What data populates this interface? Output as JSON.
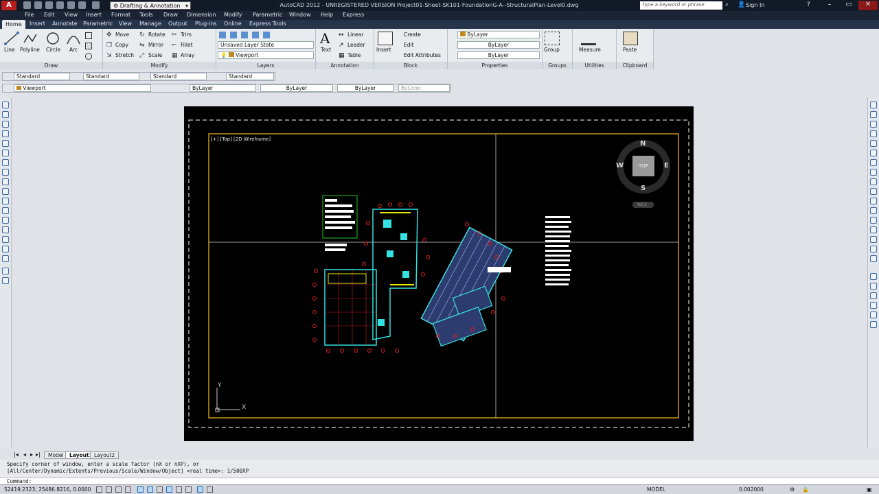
{
  "titlebar": {
    "workspace": "Drafting & Annotation",
    "title": "AutoCAD 2012 - UNREGISTERED VERSION   Project01-Sheet-SK101-FoundationG-A--StructuralPlan-Level0.dwg",
    "search_placeholder": "Type a keyword or phrase",
    "sign_in": "Sign In"
  },
  "menubar": [
    "File",
    "Edit",
    "View",
    "Insert",
    "Format",
    "Tools",
    "Draw",
    "Dimension",
    "Modify",
    "Parametric",
    "Window",
    "Help",
    "Express"
  ],
  "ribbon_tabs": [
    "Home",
    "Insert",
    "Annotate",
    "Parametric",
    "View",
    "Manage",
    "Output",
    "Plug-ins",
    "Online",
    "Express Tools"
  ],
  "ribbon": {
    "draw": {
      "title": "Draw",
      "tools": [
        "Line",
        "Polyline",
        "Circle",
        "Arc"
      ]
    },
    "modify": {
      "title": "Modify",
      "col1": [
        "Move",
        "Copy",
        "Stretch"
      ],
      "col2": [
        "Rotate",
        "Mirror",
        "Scale"
      ],
      "col3": [
        "Trim",
        "Fillet",
        "Array"
      ]
    },
    "layers": {
      "title": "Layers",
      "layer_state": "Unsaved Layer State",
      "current_layer": "Viewport"
    },
    "annotation": {
      "title": "Annotation",
      "text": "Text",
      "items": [
        "Linear",
        "Leader",
        "Table"
      ]
    },
    "block": {
      "title": "Block",
      "insert": "Insert",
      "items": [
        "Create",
        "Edit",
        "Edit Attributes"
      ]
    },
    "properties": {
      "title": "Properties",
      "color": "ByLayer",
      "linetype": "ByLayer",
      "lineweight": "ByLayer"
    },
    "groups": {
      "title": "Groups",
      "group": "Group"
    },
    "utilities": {
      "title": "Utilities",
      "measure": "Measure"
    },
    "clipboard": {
      "title": "Clipboard",
      "paste": "Paste"
    }
  },
  "styles_toolbar": {
    "text_style": "Standard",
    "dim_style": "Standard",
    "table_style": "Standard",
    "mleader_style": "Standard"
  },
  "layers_toolbar": {
    "layer": "Viewport",
    "color": "ByLayer",
    "linetype": "ByLayer",
    "lineweight": "ByLayer",
    "plotstyle": "ByColor"
  },
  "viewport": {
    "label": "[+] [Top] [2D Wireframe]"
  },
  "viewcube": {
    "n": "N",
    "s": "S",
    "e": "E",
    "w": "W",
    "face": "TOP",
    "ucs": "WCS"
  },
  "ucs_icon": {
    "x": "X",
    "y": "Y"
  },
  "layout_tabs": [
    "Model",
    "Layout1",
    "Layout2"
  ],
  "active_layout": "Layout1",
  "command": {
    "history1": "Specify corner of window, enter a scale factor (nX or nXP), or",
    "history2": "[All/Center/Dynamic/Extents/Previous/Scale/Window/Object] <real time>: 1/500XP",
    "prompt": "Command:"
  },
  "status": {
    "coords": "52419.2323, 25486.8216, 0.0000",
    "space": "MODEL",
    "scale": "0.002000"
  },
  "colors": {
    "title_bg": "#121a28",
    "ribbon_bg": "#e9ecef",
    "paper": "#000000",
    "border_line": "#c8961e",
    "ucs_gray": "#cfcfcf"
  }
}
